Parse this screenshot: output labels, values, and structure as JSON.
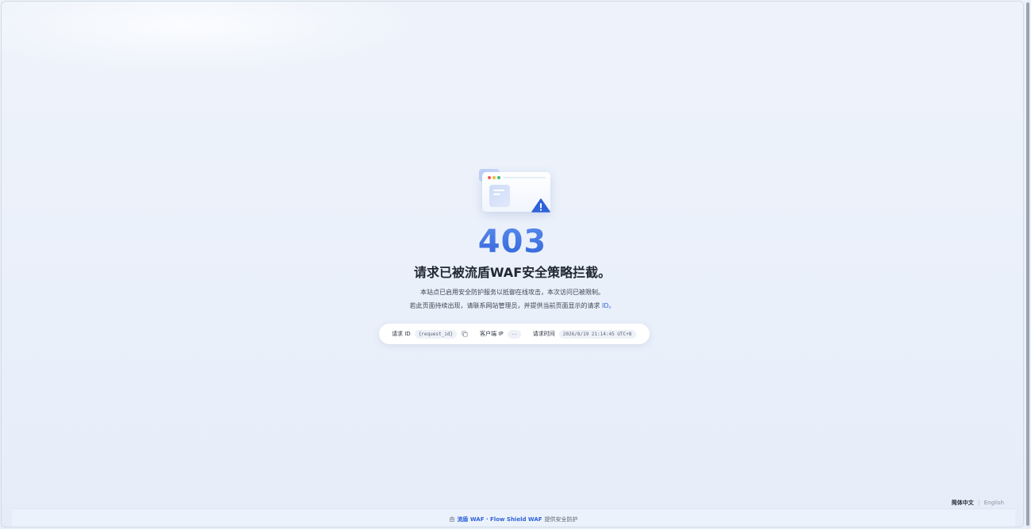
{
  "error": {
    "code": "403",
    "title": "请求已被流盾WAF安全策略拦截。",
    "desc_line1": "本站点已启用安全防护服务以抵御在线攻击，本次访问已被限制。",
    "desc_line2_prefix": "若此页面持续出现，请联系网站管理员，并提供当前页面显示的请求",
    "desc_line2_id": " ID。"
  },
  "info": {
    "request_id_label": "请求 ID",
    "request_id_value": "{request_id}",
    "client_ip_label": "客户端 IP",
    "client_ip_value": "--",
    "request_time_label": "请求时间",
    "request_time_value": "2026/8/19 21:14:45 UTC+8"
  },
  "lang": {
    "zh": "简体中文",
    "en": "English"
  },
  "footer": {
    "prefix": "由",
    "brand": "流盾 WAF · Flow Shield WAF",
    "suffix": "提供安全防护"
  },
  "colors": {
    "accent": "#2f63d8",
    "background": "#eaf0fa",
    "warning_icon": "#2f63d8"
  },
  "icons": {
    "window": "browser-window-icon",
    "warning": "warning-triangle-icon",
    "copy": "copy-icon"
  }
}
